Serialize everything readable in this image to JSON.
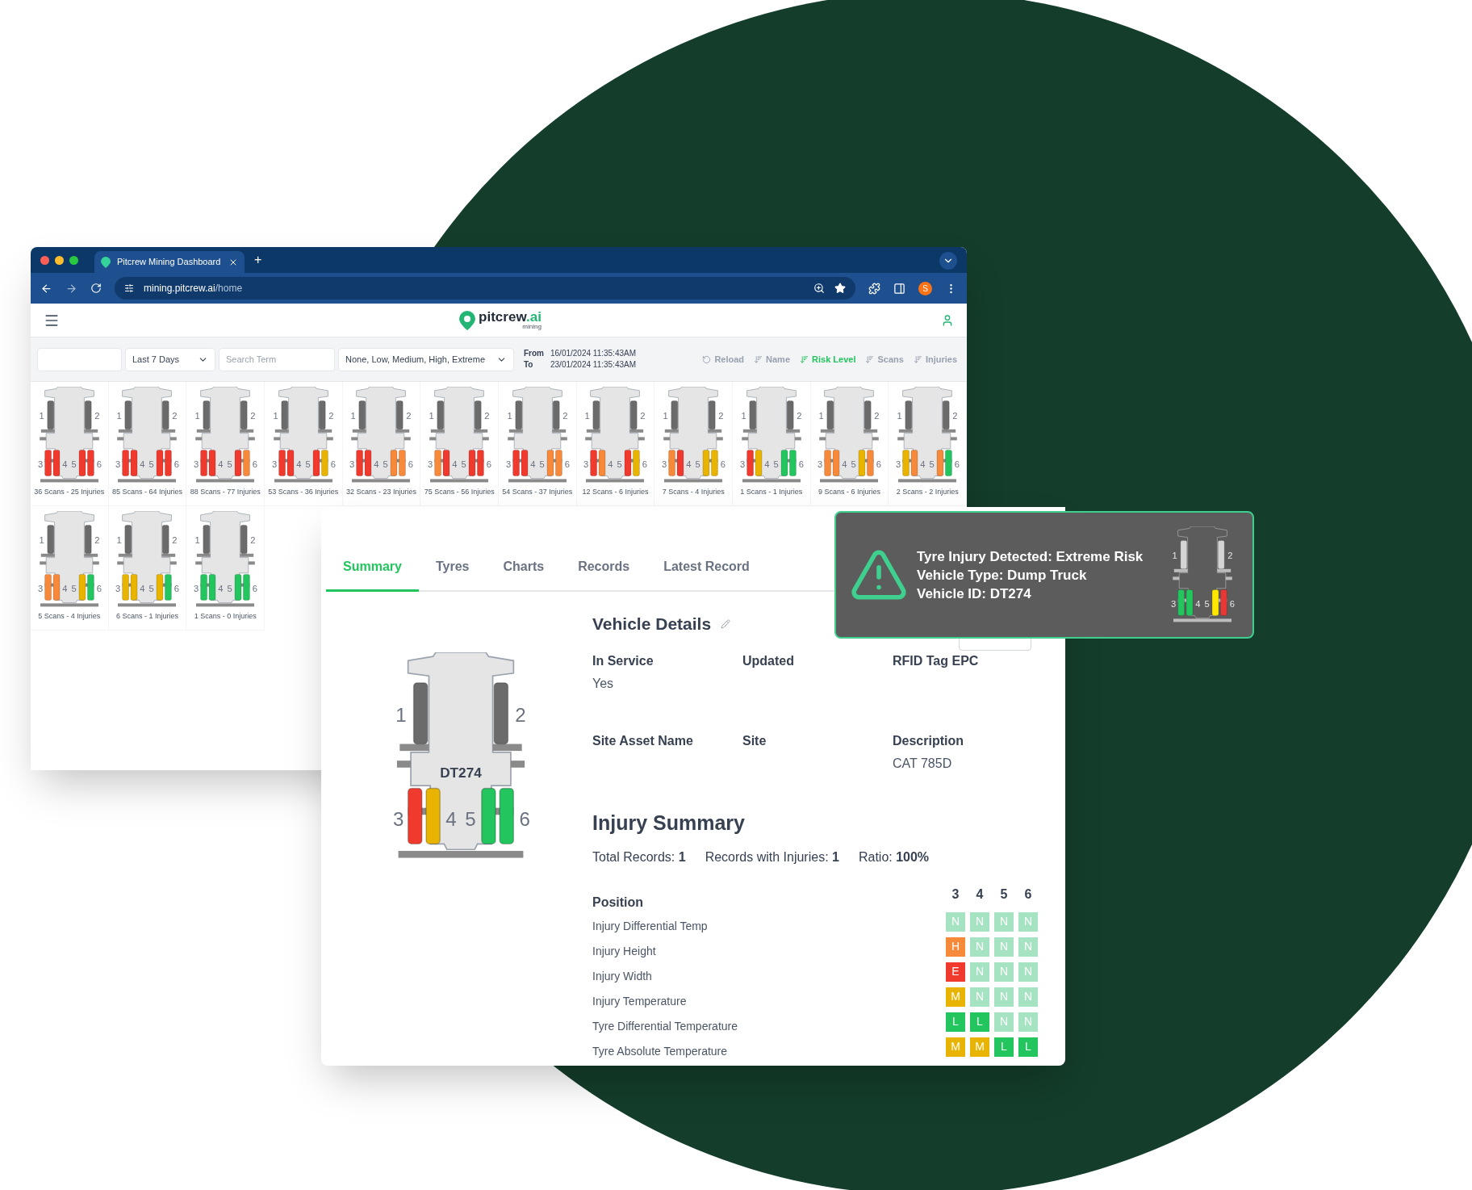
{
  "browser": {
    "tab_title": "Pitcrew Mining Dashboard",
    "new_tab": "+",
    "url_host": "mining.pitcrew.ai",
    "url_path": "/home",
    "profile_initial": "S"
  },
  "app_header": {
    "logo": {
      "name": "pitcrew",
      "accent": ".ai",
      "tagline": "mining"
    }
  },
  "filters": {
    "period": "Last 7 Days",
    "search": {
      "placeholder": "Search Term"
    },
    "risk_levels": "None, Low, Medium, High, Extreme",
    "from_label": "From",
    "from": "16/01/2024 11:35:43AM",
    "to_label": "To",
    "to": "23/01/2024 11:35:43AM",
    "reload": "Reload",
    "sort_options": [
      {
        "label": "Name",
        "selected": false
      },
      {
        "label": "Risk Level",
        "selected": true
      },
      {
        "label": "Scans",
        "selected": false
      },
      {
        "label": "Injuries",
        "selected": false
      }
    ]
  },
  "trucks": [
    {
      "caption": "36 Scans - 25 Injuries",
      "tyres": [
        {
          "label": "1",
          "color": "#6b6b6b"
        },
        {
          "label": "2",
          "color": "#6b6b6b"
        },
        {
          "label": "3",
          "color": "#f03a2e"
        },
        {
          "label": "4",
          "color": "#f03a2e"
        },
        {
          "label": "5",
          "color": "#f03a2e"
        },
        {
          "label": "6",
          "color": "#f03a2e"
        }
      ]
    },
    {
      "caption": "85 Scans - 64 Injuries",
      "tyres": [
        {
          "label": "1",
          "color": "#6b6b6b"
        },
        {
          "label": "2",
          "color": "#6b6b6b"
        },
        {
          "label": "3",
          "color": "#f03a2e"
        },
        {
          "label": "4",
          "color": "#f03a2e"
        },
        {
          "label": "5",
          "color": "#f03a2e"
        },
        {
          "label": "6",
          "color": "#f03a2e"
        }
      ]
    },
    {
      "caption": "88 Scans - 77 Injuries",
      "tyres": [
        {
          "label": "1",
          "color": "#6b6b6b"
        },
        {
          "label": "2",
          "color": "#6b6b6b"
        },
        {
          "label": "3",
          "color": "#f03a2e"
        },
        {
          "label": "4",
          "color": "#f03a2e"
        },
        {
          "label": "5",
          "color": "#f03a2e"
        },
        {
          "label": "6",
          "color": "#f7893b"
        }
      ]
    },
    {
      "caption": "53 Scans - 36 Injuries",
      "tyres": [
        {
          "label": "1",
          "color": "#6b6b6b"
        },
        {
          "label": "2",
          "color": "#6b6b6b"
        },
        {
          "label": "3",
          "color": "#f03a2e"
        },
        {
          "label": "4",
          "color": "#f03a2e"
        },
        {
          "label": "5",
          "color": "#f03a2e"
        },
        {
          "label": "6",
          "color": "#e8b400"
        }
      ]
    },
    {
      "caption": "32 Scans - 23 Injuries",
      "tyres": [
        {
          "label": "1",
          "color": "#6b6b6b"
        },
        {
          "label": "2",
          "color": "#6b6b6b"
        },
        {
          "label": "3",
          "color": "#f03a2e"
        },
        {
          "label": "4",
          "color": "#f03a2e"
        },
        {
          "label": "5",
          "color": "#f7893b"
        },
        {
          "label": "6",
          "color": "#f7893b"
        }
      ]
    },
    {
      "caption": "75 Scans - 56 Injuries",
      "tyres": [
        {
          "label": "1",
          "color": "#6b6b6b"
        },
        {
          "label": "2",
          "color": "#6b6b6b"
        },
        {
          "label": "3",
          "color": "#f7893b"
        },
        {
          "label": "4",
          "color": "#f03a2e"
        },
        {
          "label": "5",
          "color": "#f03a2e"
        },
        {
          "label": "6",
          "color": "#f03a2e"
        }
      ]
    },
    {
      "caption": "54 Scans - 37 Injuries",
      "tyres": [
        {
          "label": "1",
          "color": "#6b6b6b"
        },
        {
          "label": "2",
          "color": "#6b6b6b"
        },
        {
          "label": "3",
          "color": "#f03a2e"
        },
        {
          "label": "4",
          "color": "#f03a2e"
        },
        {
          "label": "5",
          "color": "#f7893b"
        },
        {
          "label": "6",
          "color": "#f7893b"
        }
      ]
    },
    {
      "caption": "12 Scans - 6 Injuries",
      "tyres": [
        {
          "label": "1",
          "color": "#6b6b6b"
        },
        {
          "label": "2",
          "color": "#6b6b6b"
        },
        {
          "label": "3",
          "color": "#f03a2e"
        },
        {
          "label": "4",
          "color": "#f7893b"
        },
        {
          "label": "5",
          "color": "#f03a2e"
        },
        {
          "label": "6",
          "color": "#e8b400"
        }
      ]
    },
    {
      "caption": "7 Scans - 4 Injuries",
      "tyres": [
        {
          "label": "1",
          "color": "#6b6b6b"
        },
        {
          "label": "2",
          "color": "#6b6b6b"
        },
        {
          "label": "3",
          "color": "#f7893b"
        },
        {
          "label": "4",
          "color": "#f03a2e"
        },
        {
          "label": "5",
          "color": "#e8b400"
        },
        {
          "label": "6",
          "color": "#e8b400"
        }
      ]
    },
    {
      "caption": "1 Scans - 1 Injuries",
      "tyres": [
        {
          "label": "1",
          "color": "#6b6b6b"
        },
        {
          "label": "2",
          "color": "#6b6b6b"
        },
        {
          "label": "3",
          "color": "#f03a2e"
        },
        {
          "label": "4",
          "color": "#e8b400"
        },
        {
          "label": "5",
          "color": "#22c55e"
        },
        {
          "label": "6",
          "color": "#22c55e"
        }
      ]
    },
    {
      "caption": "9 Scans - 6 Injuries",
      "tyres": [
        {
          "label": "1",
          "color": "#6b6b6b"
        },
        {
          "label": "2",
          "color": "#6b6b6b"
        },
        {
          "label": "3",
          "color": "#f7893b"
        },
        {
          "label": "4",
          "color": "#f7893b"
        },
        {
          "label": "5",
          "color": "#e8b400"
        },
        {
          "label": "6",
          "color": "#f7893b"
        }
      ]
    },
    {
      "caption": "2 Scans - 2 Injuries",
      "tyres": [
        {
          "label": "1",
          "color": "#6b6b6b"
        },
        {
          "label": "2",
          "color": "#6b6b6b"
        },
        {
          "label": "3",
          "color": "#e8b400"
        },
        {
          "label": "4",
          "color": "#f7893b"
        },
        {
          "label": "5",
          "color": "#f7893b"
        },
        {
          "label": "6",
          "color": "#22c55e"
        }
      ]
    },
    {
      "caption": "5 Scans - 4 Injuries",
      "tyres": [
        {
          "label": "1",
          "color": "#6b6b6b"
        },
        {
          "label": "2",
          "color": "#6b6b6b"
        },
        {
          "label": "3",
          "color": "#f7893b"
        },
        {
          "label": "4",
          "color": "#f7893b"
        },
        {
          "label": "5",
          "color": "#e8b400"
        },
        {
          "label": "6",
          "color": "#22c55e"
        }
      ]
    },
    {
      "caption": "6 Scans - 1 Injuries",
      "tyres": [
        {
          "label": "1",
          "color": "#6b6b6b"
        },
        {
          "label": "2",
          "color": "#6b6b6b"
        },
        {
          "label": "3",
          "color": "#e8b400"
        },
        {
          "label": "4",
          "color": "#e8b400"
        },
        {
          "label": "5",
          "color": "#e8b400"
        },
        {
          "label": "6",
          "color": "#22c55e"
        }
      ]
    },
    {
      "caption": "1 Scans - 0 Injuries",
      "tyres": [
        {
          "label": "1",
          "color": "#6b6b6b"
        },
        {
          "label": "2",
          "color": "#6b6b6b"
        },
        {
          "label": "3",
          "color": "#22c55e"
        },
        {
          "label": "4",
          "color": "#22c55e"
        },
        {
          "label": "5",
          "color": "#22c55e"
        },
        {
          "label": "6",
          "color": "#22c55e"
        }
      ]
    }
  ],
  "vehicle": {
    "tabs": [
      {
        "label": "Summary",
        "selected": true
      },
      {
        "label": "Tyres",
        "selected": false
      },
      {
        "label": "Charts",
        "selected": false
      },
      {
        "label": "Records",
        "selected": false
      },
      {
        "label": "Latest Record",
        "selected": false
      }
    ],
    "details_title": "Vehicle Details",
    "fields": [
      {
        "label": "In Service",
        "value": "Yes"
      },
      {
        "label": "Updated"
      },
      {
        "label": "RFID Tag EPC"
      },
      {
        "label": "Site Asset Name"
      },
      {
        "label": "Site"
      },
      {
        "label": "Description",
        "value": "CAT 785D"
      }
    ],
    "truck": {
      "id": "DT274",
      "tyres": [
        {
          "label": "1",
          "color": "#6b6b6b"
        },
        {
          "label": "2",
          "color": "#6b6b6b"
        },
        {
          "label": "3",
          "color": "#f03a2e"
        },
        {
          "label": "4",
          "color": "#e8b400"
        },
        {
          "label": "5",
          "color": "#22c55e"
        },
        {
          "label": "6",
          "color": "#22c55e"
        }
      ]
    },
    "injury_summary": {
      "title": "Injury Summary",
      "totals": [
        "Total Records: **1**",
        "Records with Injuries: **1**",
        "Ratio: **100%**"
      ],
      "position_label": "Position",
      "positions": [
        "3",
        "4",
        "5",
        "6"
      ],
      "rows": [
        {
          "label": "Injury Differential Temp",
          "cells": [
            {
              "code": "N",
              "color": "#a6e3c3"
            },
            {
              "code": "N",
              "color": "#a6e3c3"
            },
            {
              "code": "N",
              "color": "#a6e3c3"
            },
            {
              "code": "N",
              "color": "#a6e3c3"
            }
          ]
        },
        {
          "label": "Injury Height",
          "cells": [
            {
              "code": "H",
              "color": "#f7893b"
            },
            {
              "code": "N",
              "color": "#a6e3c3"
            },
            {
              "code": "N",
              "color": "#a6e3c3"
            },
            {
              "code": "N",
              "color": "#a6e3c3"
            }
          ]
        },
        {
          "label": "Injury Width",
          "cells": [
            {
              "code": "E",
              "color": "#f03a2e"
            },
            {
              "code": "N",
              "color": "#a6e3c3"
            },
            {
              "code": "N",
              "color": "#a6e3c3"
            },
            {
              "code": "N",
              "color": "#a6e3c3"
            }
          ]
        },
        {
          "label": "Injury Temperature",
          "cells": [
            {
              "code": "M",
              "color": "#e8b400"
            },
            {
              "code": "N",
              "color": "#a6e3c3"
            },
            {
              "code": "N",
              "color": "#a6e3c3"
            },
            {
              "code": "N",
              "color": "#a6e3c3"
            }
          ]
        },
        {
          "label": "Tyre Differential Temperature",
          "cells": [
            {
              "code": "L",
              "color": "#22c55e"
            },
            {
              "code": "L",
              "color": "#22c55e"
            },
            {
              "code": "N",
              "color": "#a6e3c3"
            },
            {
              "code": "N",
              "color": "#a6e3c3"
            }
          ]
        },
        {
          "label": "Tyre Absolute Temperature",
          "cells": [
            {
              "code": "M",
              "color": "#e8b400"
            },
            {
              "code": "M",
              "color": "#e8b400"
            },
            {
              "code": "L",
              "color": "#22c55e"
            },
            {
              "code": "L",
              "color": "#22c55e"
            }
          ]
        }
      ]
    }
  },
  "toast": {
    "lines": [
      "Tyre Injury Detected: Extreme Risk",
      "Vehicle Type: Dump Truck",
      "Vehicle ID: DT274"
    ],
    "truck": {
      "tyres": [
        {
          "label": "1",
          "color": "#d4d4d4"
        },
        {
          "label": "2",
          "color": "#d4d4d4"
        },
        {
          "label": "3",
          "color": "#22c55e"
        },
        {
          "label": "4",
          "color": "#22c55e"
        },
        {
          "label": "5",
          "color": "#ffe600"
        },
        {
          "label": "6",
          "color": "#e53935"
        }
      ]
    }
  }
}
